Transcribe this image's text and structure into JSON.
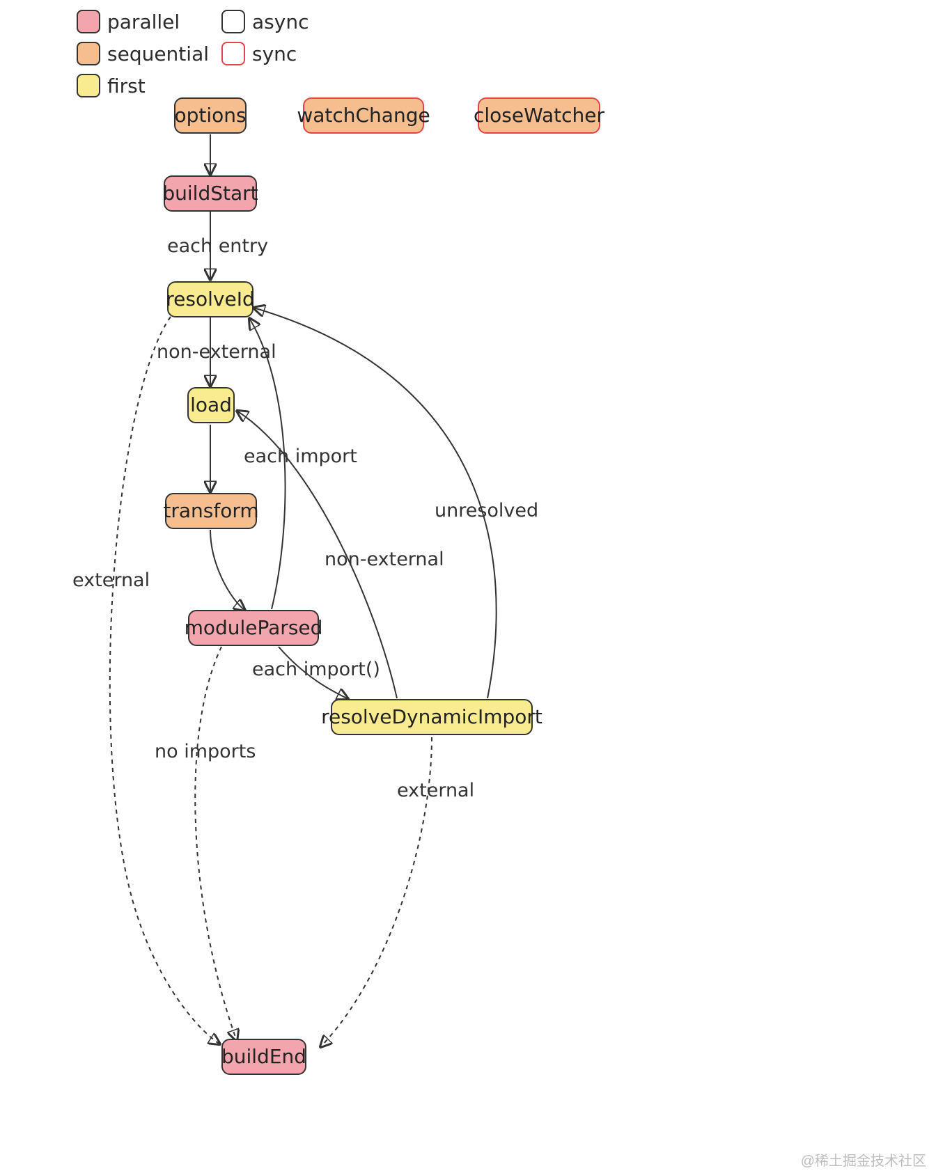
{
  "legend": {
    "parallel": "parallel",
    "sequential": "sequential",
    "first": "first",
    "async": "async",
    "sync": "sync"
  },
  "nodes": {
    "options": "options",
    "watchChange": "watchChange",
    "closeWatcher": "closeWatcher",
    "buildStart": "buildStart",
    "resolveId": "resolveId",
    "load": "load",
    "transform": "transform",
    "moduleParsed": "moduleParsed",
    "resolveDynamicImport": "resolveDynamicImport",
    "buildEnd": "buildEnd"
  },
  "edgeLabels": {
    "eachEntry": "each entry",
    "nonExternal1": "non-external",
    "external": "external",
    "eachImport": "each import",
    "nonExternal2": "non-external",
    "unresolved": "unresolved",
    "eachImportFn": "each import()",
    "noImports": "no imports",
    "external2": "external"
  },
  "watermark": "@稀土掘金技术社区",
  "colors": {
    "parallel": "#f2a5ac",
    "sequential": "#f4be8f",
    "first": "#f9eb8f",
    "asyncBorder": "#333333",
    "syncBorder": "#e04646"
  },
  "chart_data": {
    "type": "diagram",
    "title": "",
    "legend": [
      {
        "name": "parallel",
        "color": "#f2a5ac",
        "border": "async"
      },
      {
        "name": "sequential",
        "color": "#f4be8f",
        "border": "async"
      },
      {
        "name": "first",
        "color": "#f9eb8f",
        "border": "async"
      },
      {
        "name": "async",
        "color": "#ffffff",
        "border": "#333333"
      },
      {
        "name": "sync",
        "color": "#ffffff",
        "border": "#e04646"
      }
    ],
    "nodes": [
      {
        "id": "options",
        "label": "options",
        "type": "sequential",
        "mode": "async"
      },
      {
        "id": "watchChange",
        "label": "watchChange",
        "type": "sequential",
        "mode": "sync"
      },
      {
        "id": "closeWatcher",
        "label": "closeWatcher",
        "type": "sequential",
        "mode": "sync"
      },
      {
        "id": "buildStart",
        "label": "buildStart",
        "type": "parallel",
        "mode": "async"
      },
      {
        "id": "resolveId",
        "label": "resolveId",
        "type": "first",
        "mode": "async"
      },
      {
        "id": "load",
        "label": "load",
        "type": "first",
        "mode": "async"
      },
      {
        "id": "transform",
        "label": "transform",
        "type": "sequential",
        "mode": "async"
      },
      {
        "id": "moduleParsed",
        "label": "moduleParsed",
        "type": "parallel",
        "mode": "async"
      },
      {
        "id": "resolveDynamicImport",
        "label": "resolveDynamicImport",
        "type": "first",
        "mode": "async"
      },
      {
        "id": "buildEnd",
        "label": "buildEnd",
        "type": "parallel",
        "mode": "async"
      }
    ],
    "edges": [
      {
        "from": "options",
        "to": "buildStart",
        "label": "",
        "style": "solid"
      },
      {
        "from": "buildStart",
        "to": "resolveId",
        "label": "each entry",
        "style": "solid"
      },
      {
        "from": "resolveId",
        "to": "load",
        "label": "non-external",
        "style": "solid"
      },
      {
        "from": "resolveId",
        "to": "buildEnd",
        "label": "external",
        "style": "dashed"
      },
      {
        "from": "load",
        "to": "transform",
        "label": "",
        "style": "solid"
      },
      {
        "from": "transform",
        "to": "moduleParsed",
        "label": "",
        "style": "solid"
      },
      {
        "from": "moduleParsed",
        "to": "resolveId",
        "label": "each import",
        "style": "solid"
      },
      {
        "from": "moduleParsed",
        "to": "resolveDynamicImport",
        "label": "each import()",
        "style": "solid"
      },
      {
        "from": "moduleParsed",
        "to": "buildEnd",
        "label": "no imports",
        "style": "dashed"
      },
      {
        "from": "resolveDynamicImport",
        "to": "load",
        "label": "non-external",
        "style": "solid"
      },
      {
        "from": "resolveDynamicImport",
        "to": "resolveId",
        "label": "unresolved",
        "style": "solid"
      },
      {
        "from": "resolveDynamicImport",
        "to": "buildEnd",
        "label": "external",
        "style": "dashed"
      }
    ]
  }
}
